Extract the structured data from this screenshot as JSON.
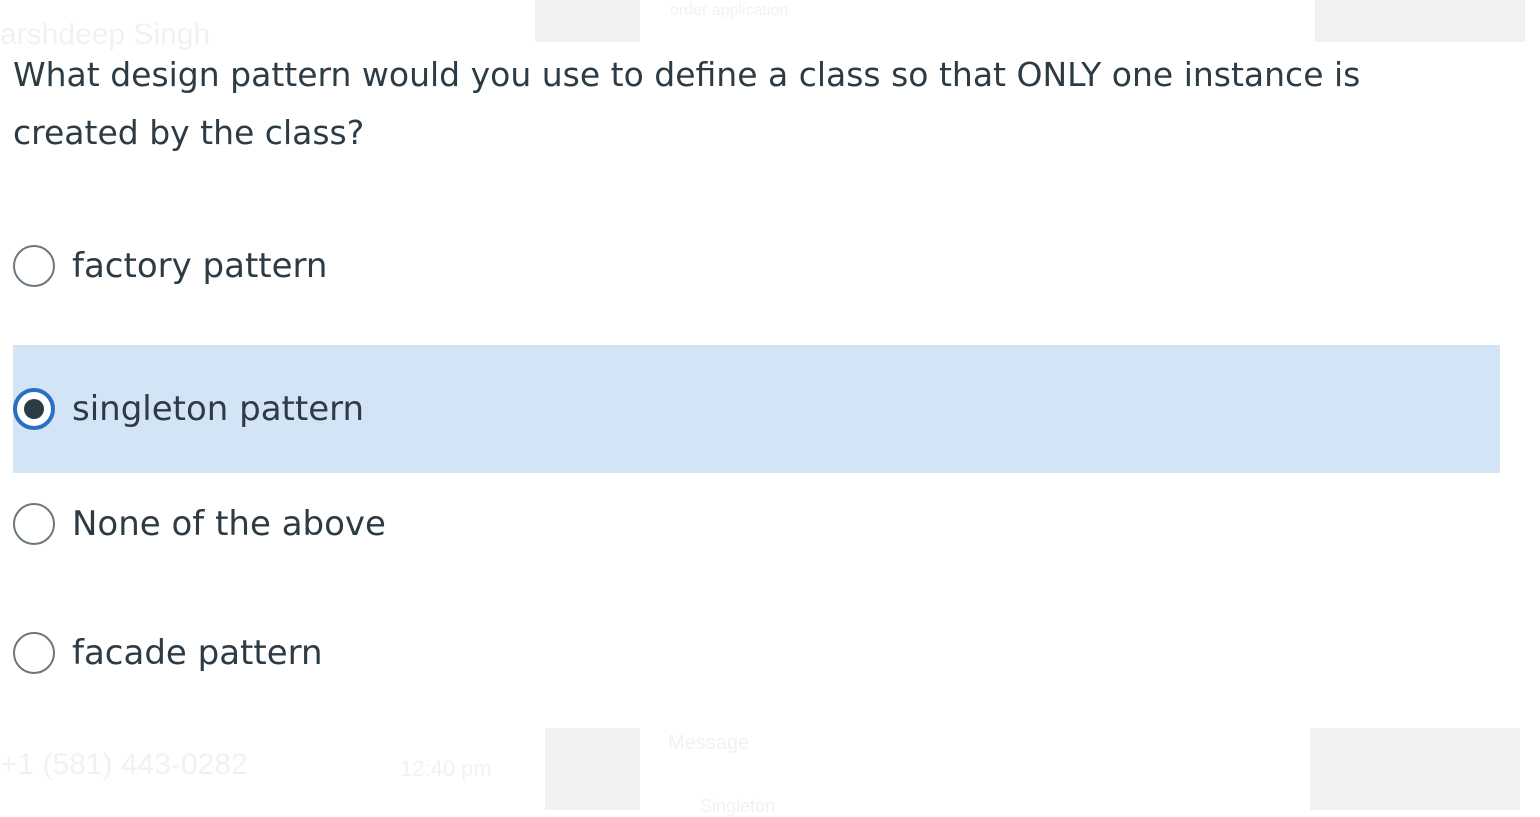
{
  "background_text": {
    "name": "arshdeep Singh",
    "preview": "order application",
    "phone": "+1 (581) 443-0282",
    "time": "12:40 pm",
    "message": "Message",
    "singleton": "Singleton"
  },
  "question": {
    "line1": "What design pattern would you use to define a class so that ONLY one instance is",
    "line2": "created by the class?"
  },
  "answers": [
    {
      "label": "factory pattern",
      "selected": false
    },
    {
      "label": "singleton pattern",
      "selected": true
    },
    {
      "label": "None of the above",
      "selected": false
    },
    {
      "label": "facade pattern",
      "selected": false
    }
  ],
  "colors": {
    "selected_bg": "#d4e4f7",
    "radio_checked": "#2b6fc2",
    "text": "#2d3b45"
  }
}
